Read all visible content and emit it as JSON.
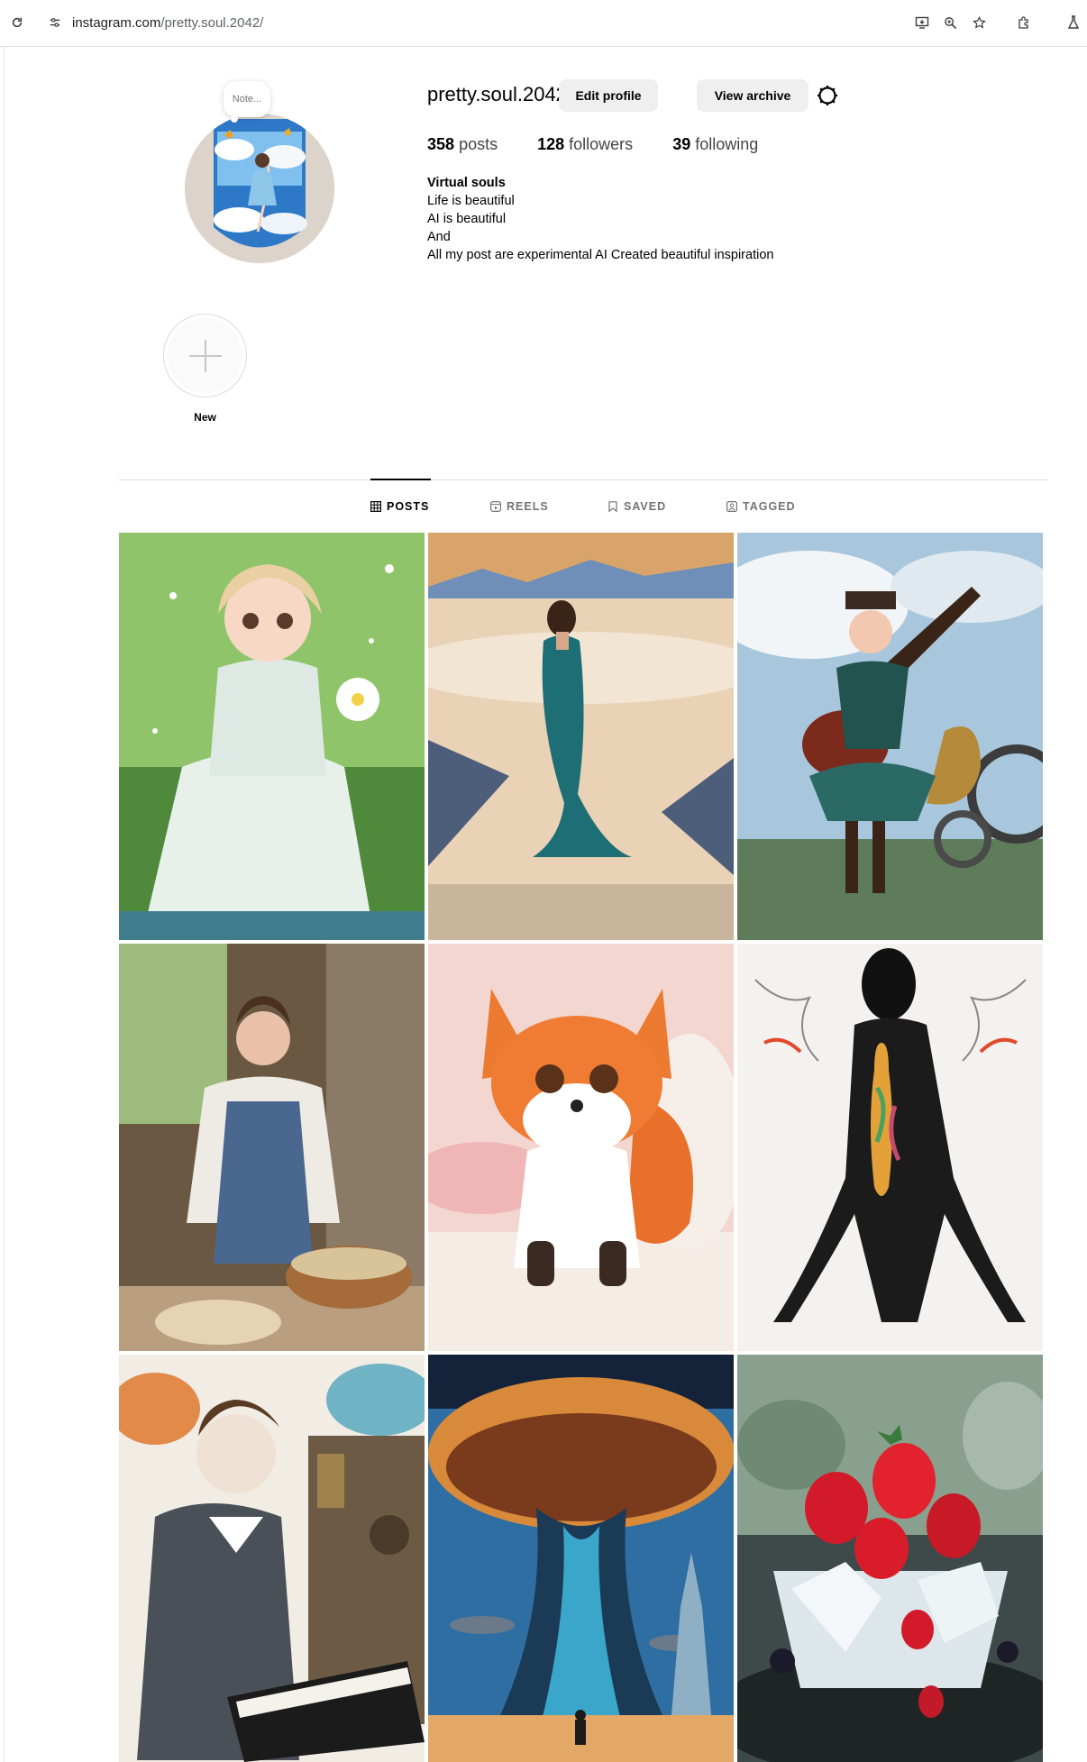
{
  "browser": {
    "url_host": "instagram.com",
    "url_path": "/pretty.soul.2042/"
  },
  "profile": {
    "note_text": "Note...",
    "username": "pretty.soul.2042",
    "edit_profile_label": "Edit profile",
    "view_archive_label": "View archive",
    "stats": {
      "posts_count": "358",
      "posts_label": "posts",
      "followers_count": "128",
      "followers_label": "followers",
      "following_count": "39",
      "following_label": "following"
    },
    "bio": {
      "name": "Virtual souls",
      "line1": "Life is beautiful",
      "line2": "AI is beautiful",
      "line3": "And",
      "line4": "All my post are experimental AI Created beautiful inspiration"
    }
  },
  "highlights": {
    "new_label": "New"
  },
  "tabs": {
    "posts": "POSTS",
    "reels": "REELS",
    "saved": "SAVED",
    "tagged": "TAGGED"
  },
  "colors": {
    "button_bg": "#efefef",
    "divider": "#dbdbdb",
    "muted_text": "#737373"
  }
}
